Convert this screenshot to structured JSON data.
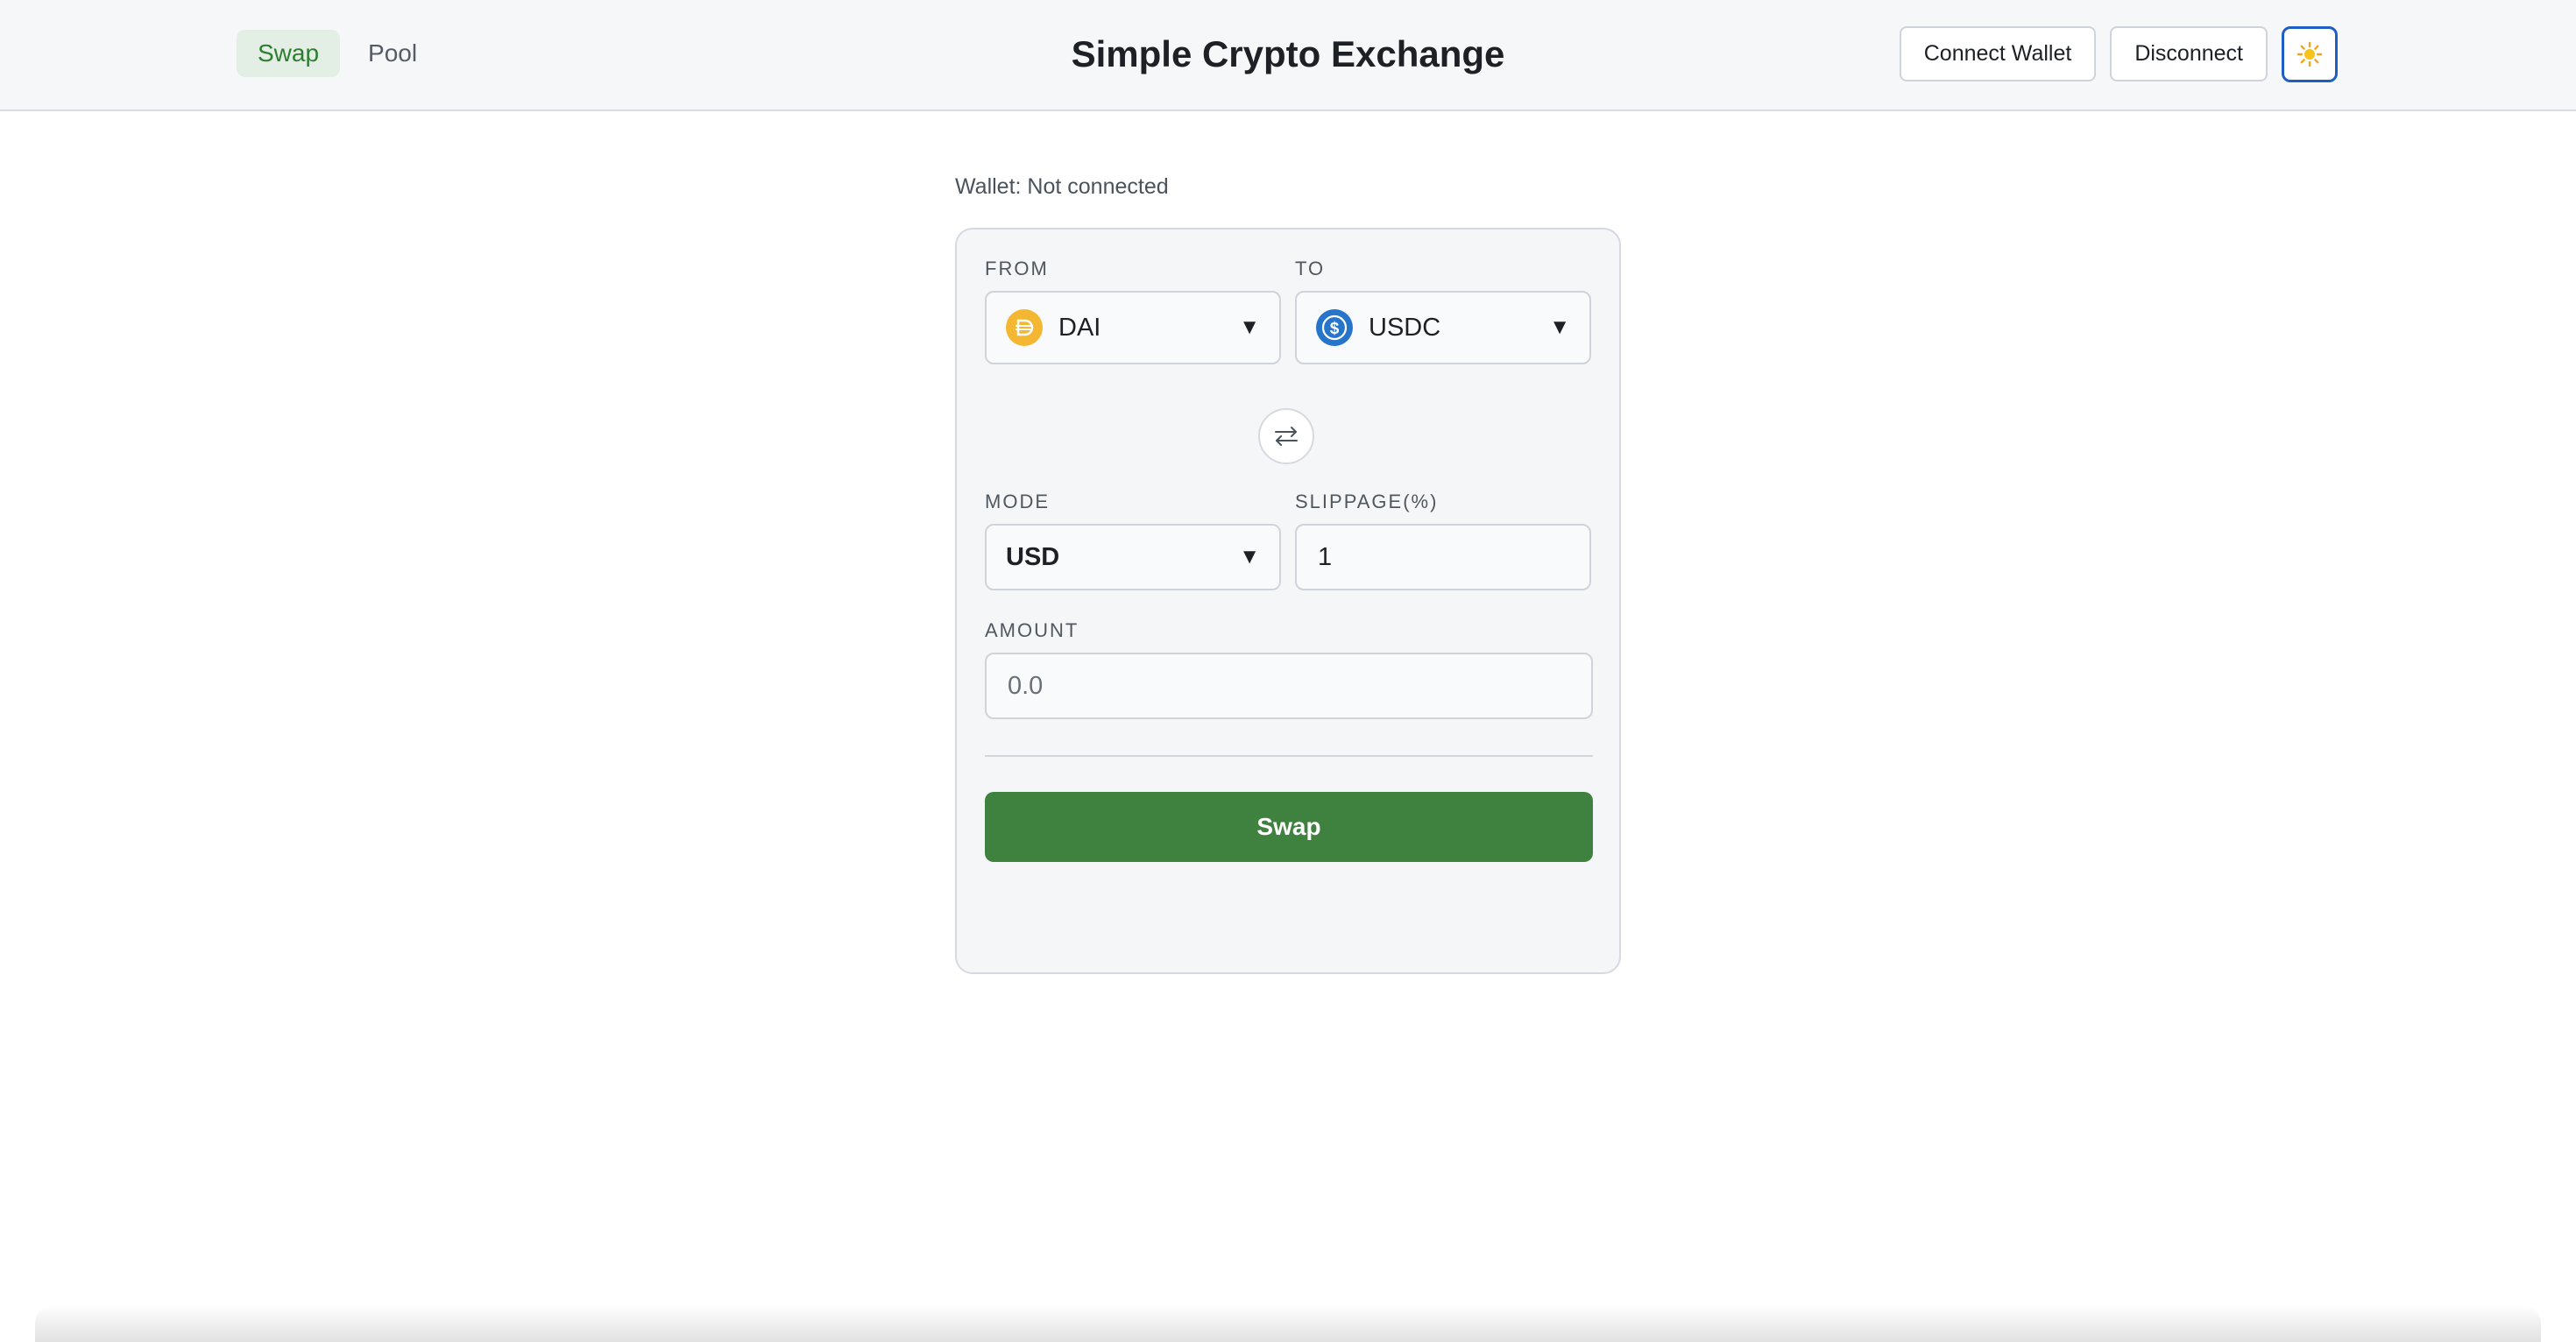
{
  "header": {
    "title": "Simple Crypto Exchange",
    "nav": [
      {
        "label": "Swap",
        "active": true
      },
      {
        "label": "Pool",
        "active": false
      }
    ],
    "connect_label": "Connect Wallet",
    "disconnect_label": "Disconnect",
    "theme_icon": "sun-icon"
  },
  "wallet_status": "Wallet: Not connected",
  "swap_form": {
    "from": {
      "label": "FROM",
      "token": "DAI",
      "icon": "dai-icon"
    },
    "to": {
      "label": "TO",
      "token": "USDC",
      "icon": "usdc-icon"
    },
    "switch_icon": "swap-arrows-icon",
    "mode": {
      "label": "MODE",
      "value": "USD"
    },
    "slippage": {
      "label": "SLIPPAGE(%)",
      "value": "1"
    },
    "amount": {
      "label": "AMOUNT",
      "placeholder": "0.0",
      "value": ""
    },
    "submit_label": "Swap"
  },
  "colors": {
    "accent_green": "#3f823f",
    "nav_active_text": "#2e7d32",
    "nav_active_bg": "#e3eee4",
    "theme_button_border": "#1f5fc4",
    "dai": "#f4b731",
    "usdc": "#2775ca"
  }
}
